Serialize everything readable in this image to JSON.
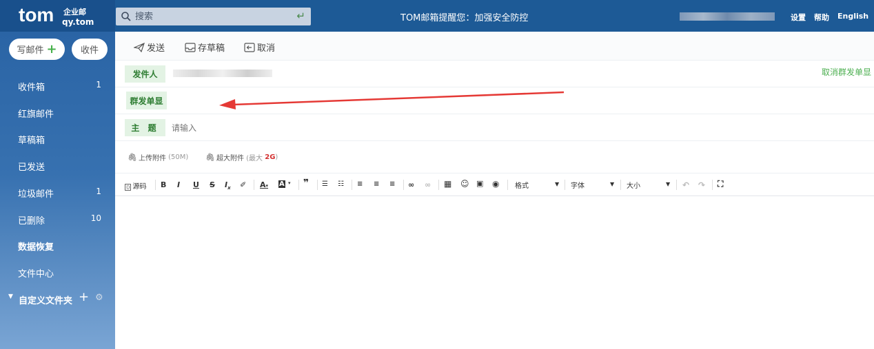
{
  "brand": {
    "name": "tom",
    "sub1": "企业邮",
    "sub2": "qy.tom"
  },
  "search": {
    "placeholder": "搜索"
  },
  "notice": "TOM邮箱提醒您：加强安全防控",
  "top_links": {
    "settings": "设置",
    "help": "帮助",
    "english": "English"
  },
  "sidebar": {
    "compose_label": "写邮件",
    "receive_label": "收件",
    "folders": [
      {
        "label": "收件箱",
        "count": "1"
      },
      {
        "label": "红旗邮件",
        "count": ""
      },
      {
        "label": "草稿箱",
        "count": ""
      },
      {
        "label": "已发送",
        "count": ""
      },
      {
        "label": "垃圾邮件",
        "count": "1"
      },
      {
        "label": "已删除",
        "count": "10"
      },
      {
        "label": "数据恢复",
        "count": ""
      },
      {
        "label": "文件中心",
        "count": ""
      }
    ],
    "custom_folder_label": "自定义文件夹"
  },
  "toolbar": {
    "send": "发送",
    "save_draft": "存草稿",
    "cancel": "取消"
  },
  "form": {
    "sender_label": "发件人",
    "cancel_group_single": "取消群发单显",
    "group_single_label": "群发单显",
    "subject_label": "主 题",
    "subject_placeholder": "请输入"
  },
  "attachments": {
    "upload": "上传附件",
    "upload_limit": "(50M)",
    "large": "超大附件",
    "large_prefix": "(最大",
    "large_size": "2G",
    "large_suffix": ")"
  },
  "editor": {
    "source": "源码",
    "format": "格式",
    "font": "字体",
    "size": "大小"
  },
  "colors": {
    "topbar": "#1d5a96",
    "accent_green": "#4caf50",
    "arrow_red": "#e53935"
  }
}
